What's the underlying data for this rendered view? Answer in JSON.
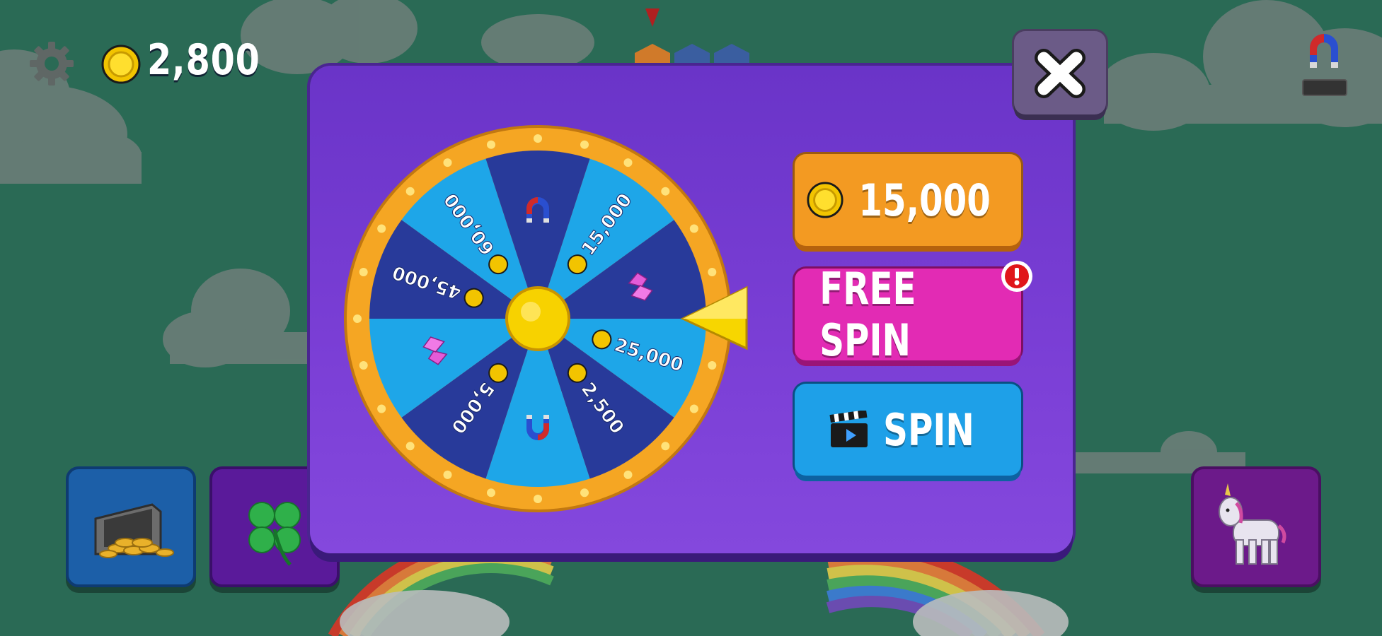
{
  "hud": {
    "coins": "2,800",
    "settings_icon": "gear-icon",
    "coin_icon": "coin-icon",
    "magnet_icon": "magnet-icon"
  },
  "spin_modal": {
    "wheel": {
      "segments": [
        {
          "prize": "15,000",
          "type": "coins"
        },
        {
          "prize": "",
          "type": "gems"
        },
        {
          "prize": "25,000",
          "type": "coins"
        },
        {
          "prize": "2,500",
          "type": "coins"
        },
        {
          "prize": "",
          "type": "magnet"
        },
        {
          "prize": "5,000",
          "type": "coins"
        },
        {
          "prize": "",
          "type": "gems"
        },
        {
          "prize": "45,000",
          "type": "coins"
        },
        {
          "prize": "60,000",
          "type": "coins"
        },
        {
          "prize": "",
          "type": "magnet"
        }
      ]
    },
    "buy_button": {
      "label": "15,000",
      "icon": "coin-icon"
    },
    "free_spin_button": {
      "label": "FREE SPIN",
      "badge_icon": "alert-icon"
    },
    "ad_spin_button": {
      "label": "SPIN",
      "icon": "clapperboard-icon"
    },
    "close_icon": "close-icon"
  },
  "side_buttons": [
    {
      "name": "gold-cart",
      "icon": "coin-cart-icon"
    },
    {
      "name": "clover",
      "icon": "clover-icon"
    },
    {
      "name": "unicorn",
      "icon": "unicorn-icon"
    }
  ],
  "colors": {
    "background": "#2a6a55",
    "modal": "#7b3fd6",
    "wheel_rim": "#f5a623",
    "segment_light": "#1ea6e8",
    "segment_dark": "#283a9a",
    "buy_button": "#f39a22",
    "free_spin_button": "#e22bb4",
    "spin_button": "#1ea0e8"
  }
}
